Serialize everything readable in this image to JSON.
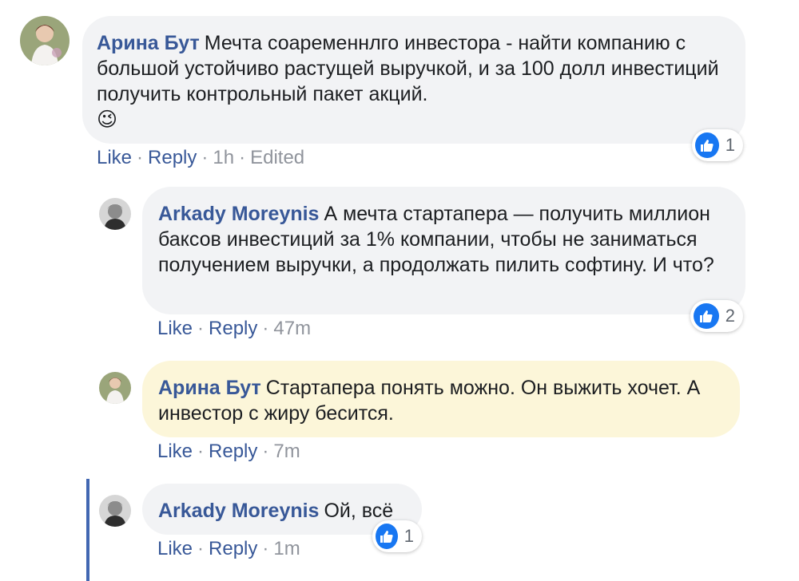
{
  "accent": "#385898",
  "comments": [
    {
      "author": "Арина Бут",
      "text": "Мечта соаременнлго инвестора - найти компанию с большой устойчиво растущей выручкой, и за 100 долл инвестиций получить контрольный пакет акций.",
      "emoji": "😉",
      "like": "Like",
      "reply": "Reply",
      "time": "1h",
      "edited": "Edited",
      "reactions": "1"
    },
    {
      "author": "Arkady Moreynis",
      "text": "А мечта стартапера — получить миллион баксов инвестиций за 1% компании, чтобы не заниматься получением выручки, а продолжать пилить софтину. И что?",
      "like": "Like",
      "reply": "Reply",
      "time": "47m",
      "reactions": "2"
    },
    {
      "author": "Арина Бут",
      "text": "Стартапера понять можно. Он выжить хочет. А инвестор с жиру бесится.",
      "like": "Like",
      "reply": "Reply",
      "time": "7m"
    },
    {
      "author": "Arkady Moreynis",
      "text": "Ой, всё",
      "like": "Like",
      "reply": "Reply",
      "time": "1m",
      "reactions": "1"
    }
  ],
  "icons": {
    "avatar_1": "user-photo-woman",
    "avatar_2": "user-photo-man",
    "reaction": "thumbs-up-icon"
  }
}
